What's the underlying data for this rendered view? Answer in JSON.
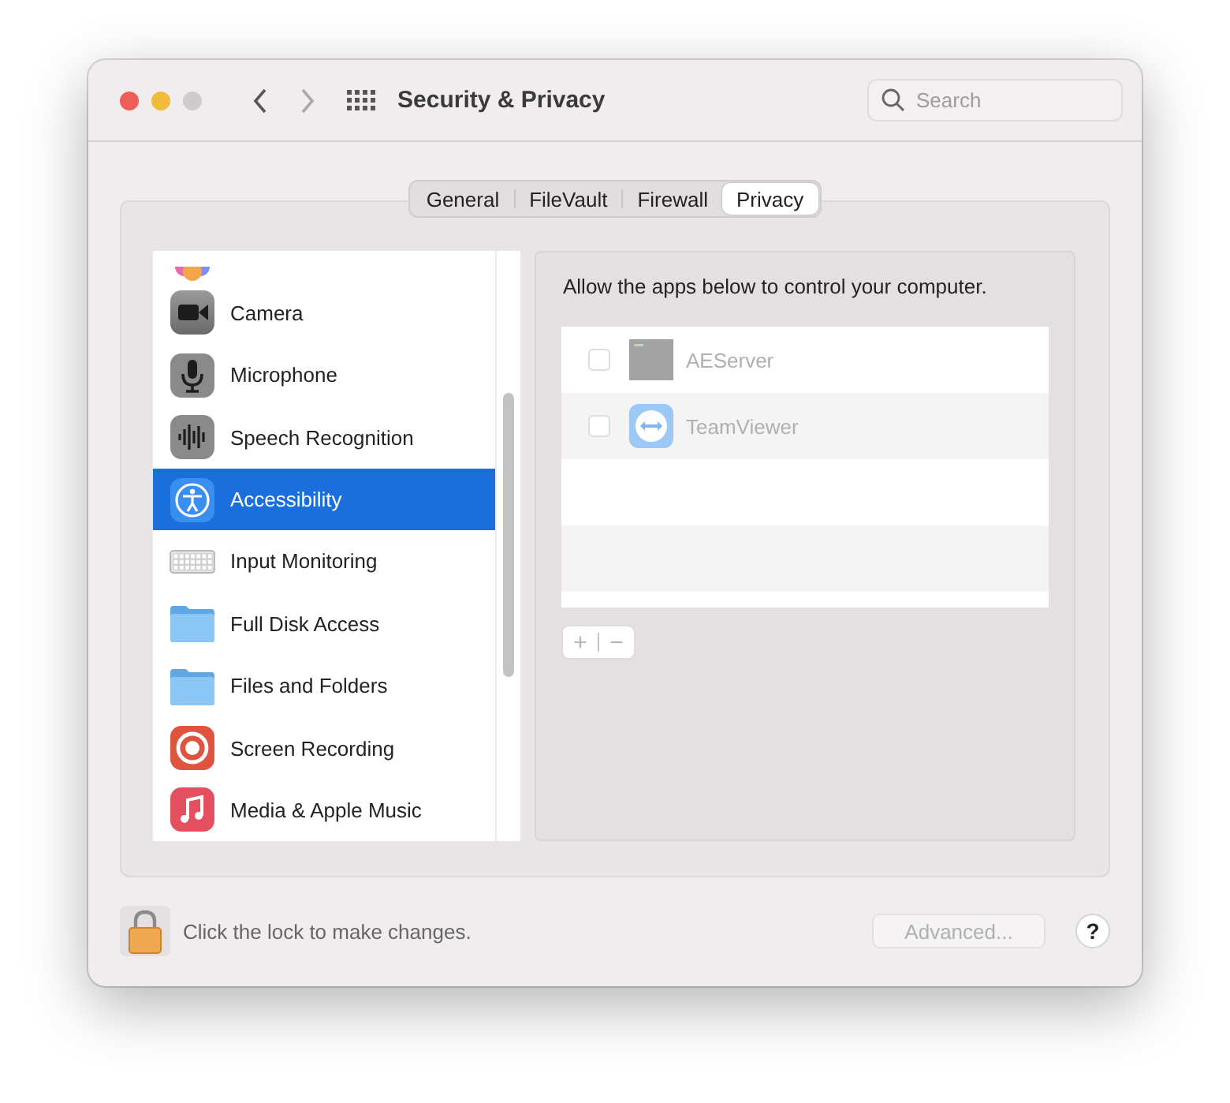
{
  "window": {
    "title": "Security & Privacy"
  },
  "search": {
    "placeholder": "Search"
  },
  "tabs": [
    {
      "label": "General",
      "selected": false
    },
    {
      "label": "FileVault",
      "selected": false
    },
    {
      "label": "Firewall",
      "selected": false
    },
    {
      "label": "Privacy",
      "selected": true
    }
  ],
  "sidebar": {
    "items": [
      {
        "label": "Camera",
        "kind": "camera",
        "selected": false
      },
      {
        "label": "Microphone",
        "kind": "microphone",
        "selected": false
      },
      {
        "label": "Speech Recognition",
        "kind": "speech",
        "selected": false
      },
      {
        "label": "Accessibility",
        "kind": "accessibility",
        "selected": true
      },
      {
        "label": "Input Monitoring",
        "kind": "keyboard",
        "selected": false
      },
      {
        "label": "Full Disk Access",
        "kind": "folder",
        "selected": false
      },
      {
        "label": "Files and Folders",
        "kind": "folder",
        "selected": false
      },
      {
        "label": "Screen Recording",
        "kind": "record",
        "selected": false
      },
      {
        "label": "Media & Apple Music",
        "kind": "music",
        "selected": false
      }
    ]
  },
  "panel": {
    "description": "Allow the apps below to control your computer.",
    "apps": [
      {
        "name": "AEServer",
        "kind": "terminal",
        "checked": false,
        "disabled": true
      },
      {
        "name": "TeamViewer",
        "kind": "teamviewer",
        "checked": false,
        "disabled": true
      }
    ],
    "add_button": "+",
    "remove_button": "−"
  },
  "footer": {
    "lock_text": "Click the lock to make changes.",
    "advanced_button": "Advanced...",
    "help_button": "?"
  }
}
